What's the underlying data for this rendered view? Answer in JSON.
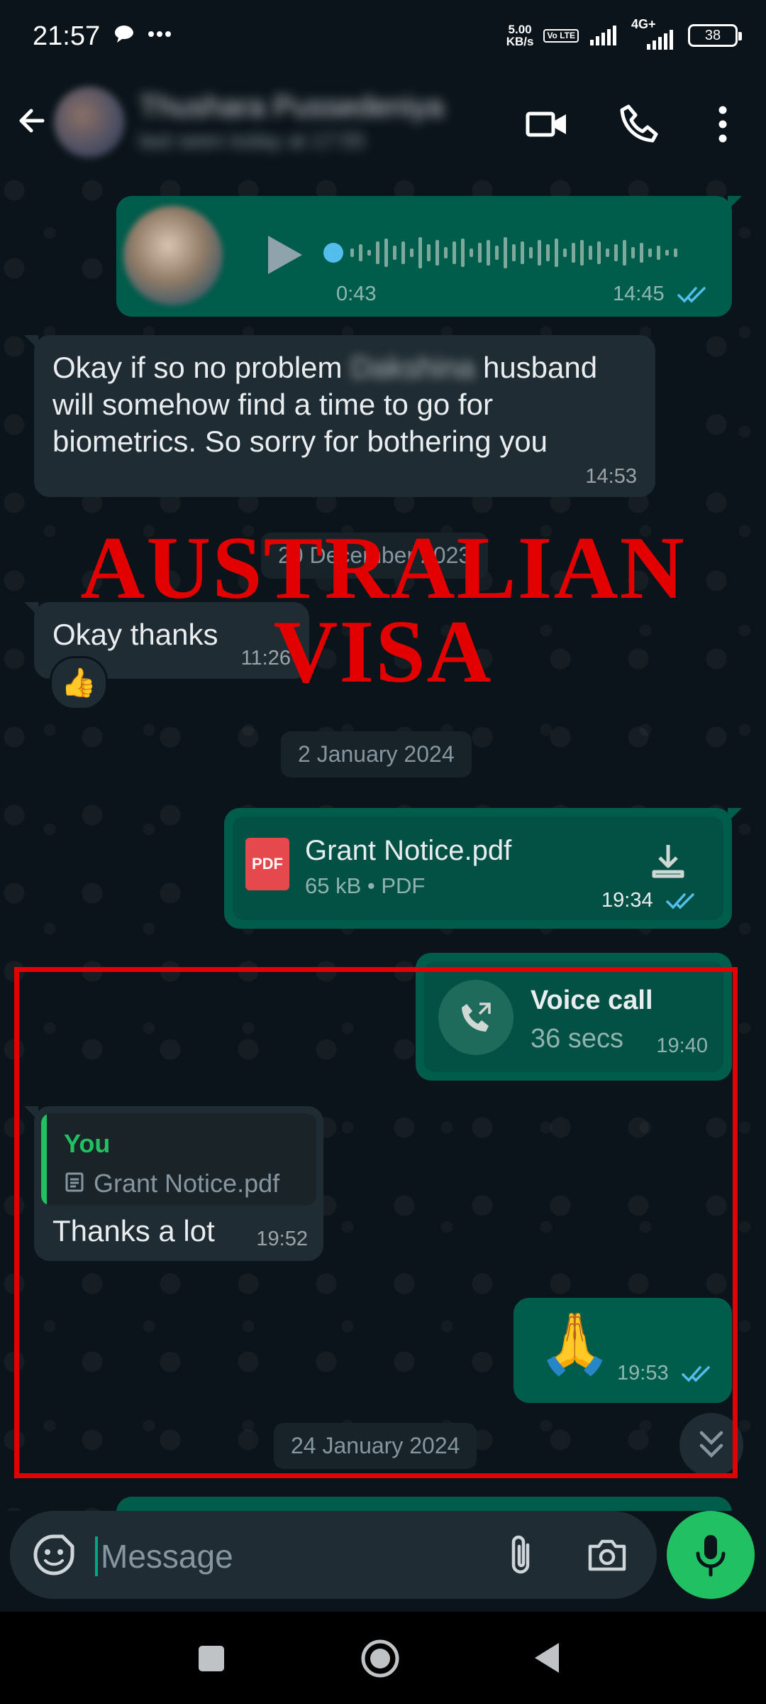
{
  "status_bar": {
    "time": "21:57",
    "net_speed_value": "5.00",
    "net_speed_unit": "KB/s",
    "volte_tag": "Vo LTE",
    "network_type": "4G+",
    "battery": "38"
  },
  "header": {
    "contact_name": "Thushara Pussedeniya",
    "contact_status": "last seen today at 17:55"
  },
  "messages": {
    "voice_note": {
      "duration": "0:43",
      "time": "14:45"
    },
    "msg1": {
      "line1_start": "Okay if so no problem",
      "redacted_name": "Dakshina",
      "line1_end": "husband",
      "line2": "will somehow find a time to go for",
      "line3": "biometrics. So sorry for bothering you",
      "time": "14:53"
    },
    "date_dec": "20 December 2023",
    "msg2": {
      "text": "Okay thanks",
      "time": "11:26",
      "reaction": "👍"
    },
    "date_jan2": "2 January 2024",
    "pdf": {
      "badge": "PDF",
      "filename": "Grant Notice.pdf",
      "meta": "65 kB • PDF",
      "time": "19:34"
    },
    "call": {
      "title": "Voice call",
      "duration": "36 secs",
      "time": "19:40"
    },
    "reply": {
      "quoted_author": "You",
      "quoted_file": "Grant Notice.pdf",
      "text": "Thanks a lot",
      "time": "19:52"
    },
    "emoji_msg": {
      "emoji": "🙏",
      "time": "19:53"
    },
    "date_jan24": "24 January 2024"
  },
  "watermark": {
    "line1": "AUSTRALIAN",
    "line2": "VISA"
  },
  "compose": {
    "placeholder": "Message"
  },
  "colors": {
    "accent_green": "#21c063",
    "outgoing_bubble": "#005c4b",
    "incoming_bubble": "#202c33",
    "read_tick": "#53bdeb",
    "highlight_box": "#e30000"
  },
  "icons": [
    "back-arrow-icon",
    "video-call-icon",
    "phone-icon",
    "more-vert-icon",
    "play-icon",
    "double-check-icon",
    "pdf-icon",
    "download-icon",
    "call-made-icon",
    "document-icon",
    "scroll-down-icon",
    "sticker-icon",
    "attach-icon",
    "camera-icon",
    "mic-icon",
    "nav-recent-icon",
    "nav-home-icon",
    "nav-back-icon"
  ]
}
